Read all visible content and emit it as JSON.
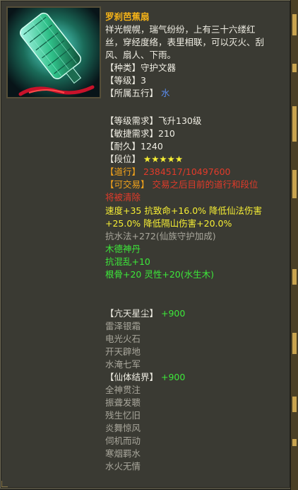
{
  "item": {
    "name": "罗刹芭蕉扇",
    "description": [
      "祥光幌幌，瑞气纷纷，上有三十六缕红",
      "丝，穿经度络，表里相联，可以灭火、刮",
      "风、扇人、下雨。"
    ],
    "type_label": "【种类】",
    "type_value": "守护文器",
    "level_label": "【等级】",
    "level_value": "3",
    "element_label": "【所属五行】",
    "element_value": "水",
    "req_level_label": "【等级需求】",
    "req_level_value": "飞升130级",
    "req_agility_label": "【敏捷需求】",
    "req_agility_value": "210",
    "durability_label": "【耐久】",
    "durability_value": "1240",
    "rank_label": "【段位】",
    "rank_stars": "★★★★★",
    "dao_label": "【道行】",
    "dao_value": "2384517/10497600",
    "trade_label": "【可交易】",
    "trade_text_1": "交易之后目前的道行和段位",
    "trade_text_2": "将被清除",
    "stats_yellow_1": "速度+35  抗致命+16.0%  降低仙法伤害",
    "stats_yellow_2": "+25.0%  降低隔山伤害+20.0%",
    "stat_gray": "抗水法+272(仙族守护加成)",
    "green_1": "木德神丹",
    "green_2": "抗混乱+10",
    "green_3": "根骨+20 灵性+20(水生木)"
  },
  "skills": [
    {
      "header": "【亢天星尘】",
      "bonus": "+900",
      "items": [
        "雷泽银霜",
        "电光火石",
        "开天辟地",
        "水淹七军"
      ]
    },
    {
      "header": "【仙体结界】",
      "bonus": "+900",
      "items": [
        "全神贯注",
        "振聋发聩",
        "残生忆旧",
        "炎舞惊风",
        "伺机而动",
        "寒烟羁水",
        "水火无情"
      ]
    }
  ],
  "colors": {
    "title": "#f5b318",
    "yellow": "#f6ee34",
    "red": "#e23a2a",
    "green": "#3de83a",
    "blue": "#5a8cf0",
    "gray": "#a9a79c"
  },
  "icons": {
    "item_image": "fan-weapon-icon"
  }
}
